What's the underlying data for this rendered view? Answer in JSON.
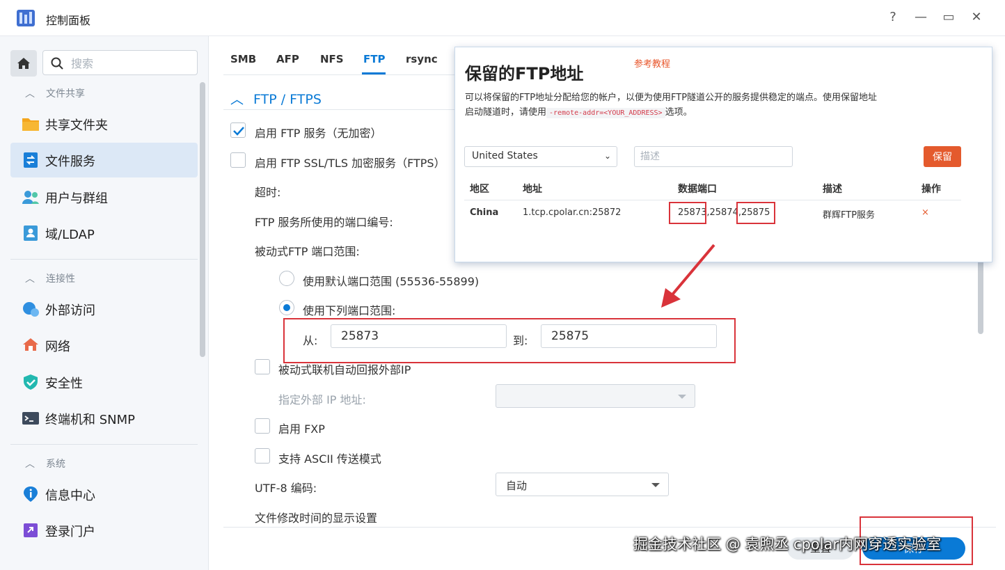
{
  "window": {
    "title": "控制面板",
    "help": "?",
    "minimize": "—",
    "maximize": "▭",
    "close": "✕"
  },
  "sidebar": {
    "search_placeholder": "搜索",
    "sections": [
      {
        "label": "文件共享",
        "items": [
          "共享文件夹",
          "文件服务",
          "用户与群组",
          "域/LDAP"
        ]
      },
      {
        "label": "连接性",
        "items": [
          "外部访问",
          "网络",
          "安全性",
          "终端机和 SNMP"
        ]
      },
      {
        "label": "系统",
        "items": [
          "信息中心",
          "登录门户"
        ]
      }
    ],
    "active_item": "文件服务"
  },
  "main": {
    "tabs": [
      "SMB",
      "AFP",
      "NFS",
      "FTP",
      "rsync"
    ],
    "active_tab": "FTP",
    "group_title": "FTP / FTPS",
    "enable_ftp": "启用 FTP 服务（无加密）",
    "enable_ftps": "启用 FTP SSL/TLS 加密服务（FTPS）",
    "timeout_label": "超时:",
    "port_label": "FTP 服务所使用的端口编号:",
    "passive_label": "被动式FTP 端口范围:",
    "default_range": "使用默认端口范围 (55536-55899)",
    "custom_range": "使用下列端口范围:",
    "from_label": "从:",
    "from_value": "25873",
    "to_label": "到:",
    "to_value": "25875",
    "report_ip": "被动式联机自动回报外部IP",
    "ext_ip_label": "指定外部 IP 地址:",
    "enable_fxp": "启用 FXP",
    "ascii_mode": "支持 ASCII 传送模式",
    "utf8_label": "UTF-8 编码:",
    "utf8_value": "自动",
    "mtime_label": "文件修改时间的显示设置",
    "reset_button": "重置",
    "save_button": "保存"
  },
  "popup": {
    "title": "保留的FTP地址",
    "link": "参考教程",
    "desc_before": "可以将保留的FTP地址分配给您的帐户，以便为使用FTP隧道公开的服务提供稳定的端点。使用保留地址启动隧道时，请使用",
    "desc_code": "-remote-addr=<YOUR_ADDRESS>",
    "desc_after": "选项。",
    "region_value": "United States",
    "desc_placeholder": "描述",
    "reserve_button": "保留",
    "columns": [
      "地区",
      "地址",
      "数据端口",
      "描述",
      "操作"
    ],
    "row": {
      "region": "China",
      "address": "1.tcp.cpolar.cn:25872",
      "port_a": "25873",
      "port_sep": ",25874,",
      "port_b": "25875",
      "desc": "群辉FTP服务",
      "action": "×"
    }
  },
  "watermark": "掘金技术社区 @ 袁煦丞 cpolar内网穿透实验室",
  "colors": {
    "accent": "#0a7ad6",
    "popup_button": "#e45a2d",
    "annotation": "#d9333a"
  }
}
